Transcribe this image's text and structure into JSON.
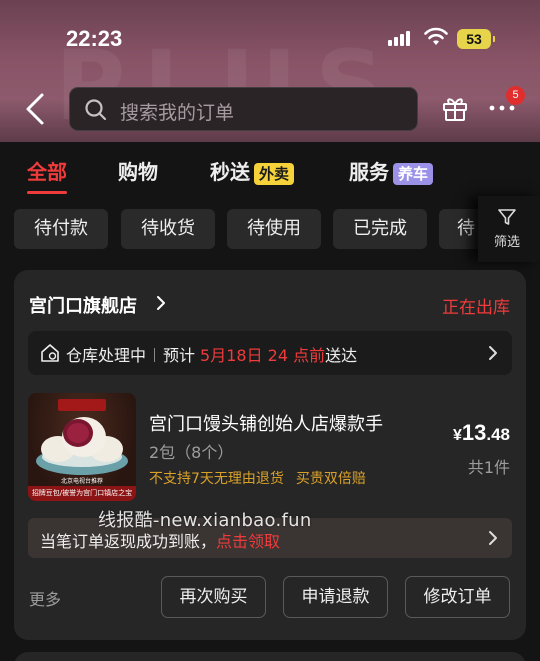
{
  "status_bar": {
    "time": "22:23",
    "battery": "53"
  },
  "header": {
    "search_placeholder": "搜索我的订单",
    "notification_count": "5"
  },
  "main_tabs": [
    {
      "label": "全部",
      "active": true
    },
    {
      "label": "购物",
      "active": false
    },
    {
      "label": "秒送",
      "tag": "外卖",
      "active": false
    },
    {
      "label": "服务",
      "tag": "养车",
      "active": false
    }
  ],
  "sub_tabs": [
    "待付款",
    "待收货",
    "待使用",
    "已完成",
    "待"
  ],
  "filter_label": "筛选",
  "order": {
    "shop_name": "宫门口旗舰店",
    "status": "正在出库",
    "logistics": {
      "stage": "仓库处理中",
      "prefix": "预计",
      "time": "5月18日 24 点前",
      "suffix": "送达"
    },
    "product": {
      "image_caption_top": "北京电视台推荐",
      "image_caption_bottom": "招牌豆包/被誉为宫门口镇店之宝",
      "title": "宫门口馒头铺创始人店爆款手",
      "spec": "2包（8个）",
      "notes": [
        "不支持7天无理由退货",
        "买贵双倍赔"
      ],
      "price_currency": "¥",
      "price_integer": "13",
      "price_decimal": ".48",
      "quantity": "共1件"
    },
    "cashback": {
      "text": "当笔订单返现成功到账，",
      "link": "点击领取"
    },
    "more_label": "更多",
    "actions": [
      "再次购买",
      "申请退款",
      "修改订单"
    ]
  },
  "watermark": "线报酷-new.xianbao.fun",
  "colors": {
    "accent_red": "#ef3b3b",
    "tag_yellow": "#f5d23a",
    "tag_purple": "#9b92e8",
    "note_orange": "#d9a12a"
  }
}
